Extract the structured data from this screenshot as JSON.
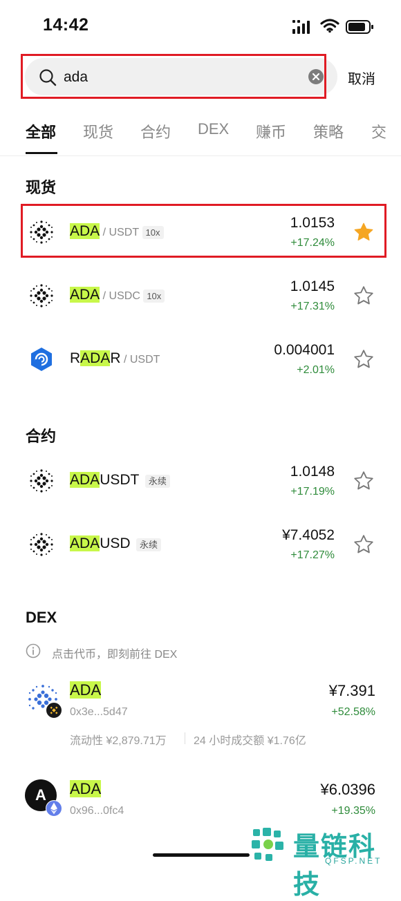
{
  "status_bar": {
    "time": "14:42"
  },
  "search": {
    "value": "ada",
    "cancel_label": "取消"
  },
  "tabs": [
    {
      "label": "全部",
      "active": true
    },
    {
      "label": "现货"
    },
    {
      "label": "合约"
    },
    {
      "label": "DEX"
    },
    {
      "label": "赚币"
    },
    {
      "label": "策略"
    },
    {
      "label": "交"
    }
  ],
  "spot": {
    "title": "现货",
    "rows": [
      {
        "sym_hl": "ADA",
        "sym_pre": "",
        "sym_post": "",
        "quote": "/ USDT",
        "badge": "10x",
        "price": "1.0153",
        "change": "+17.24%",
        "favorited": true
      },
      {
        "sym_hl": "ADA",
        "sym_pre": "",
        "sym_post": "",
        "quote": "/ USDC",
        "badge": "10x",
        "price": "1.0145",
        "change": "+17.31%",
        "favorited": false
      },
      {
        "sym_hl": "ADA",
        "sym_pre": "R",
        "sym_post": "R",
        "quote": "/ USDT",
        "badge": "",
        "price": "0.004001",
        "change": "+2.01%",
        "favorited": false
      }
    ]
  },
  "futures": {
    "title": "合约",
    "rows": [
      {
        "sym_hl": "ADA",
        "sym_post": "USDT",
        "badge": "永续",
        "price": "1.0148",
        "change": "+17.19%",
        "favorited": false
      },
      {
        "sym_hl": "ADA",
        "sym_post": "USD",
        "badge": "永续",
        "price": "¥7.4052",
        "change": "+17.27%",
        "favorited": false
      }
    ]
  },
  "dex": {
    "title": "DEX",
    "note": "点击代币，即刻前往 DEX",
    "rows": [
      {
        "symbol": "ADA",
        "address": "0x3e...5d47",
        "price": "¥7.391",
        "change": "+52.58%",
        "liquidity": "流动性 ¥2,879.71万",
        "volume": "24 小时成交额 ¥1.76亿"
      },
      {
        "symbol": "ADA",
        "avatar_letter": "A",
        "address": "0x96...0fc4",
        "price": "¥6.0396",
        "change": "+19.35%"
      }
    ]
  },
  "watermark": {
    "text": "量链科技",
    "sub": "QFSP.NET"
  },
  "colors": {
    "highlight": "#c8f74a",
    "positive": "#2e8b3a",
    "star": "#f5a623",
    "annotation": "#e01b24"
  }
}
